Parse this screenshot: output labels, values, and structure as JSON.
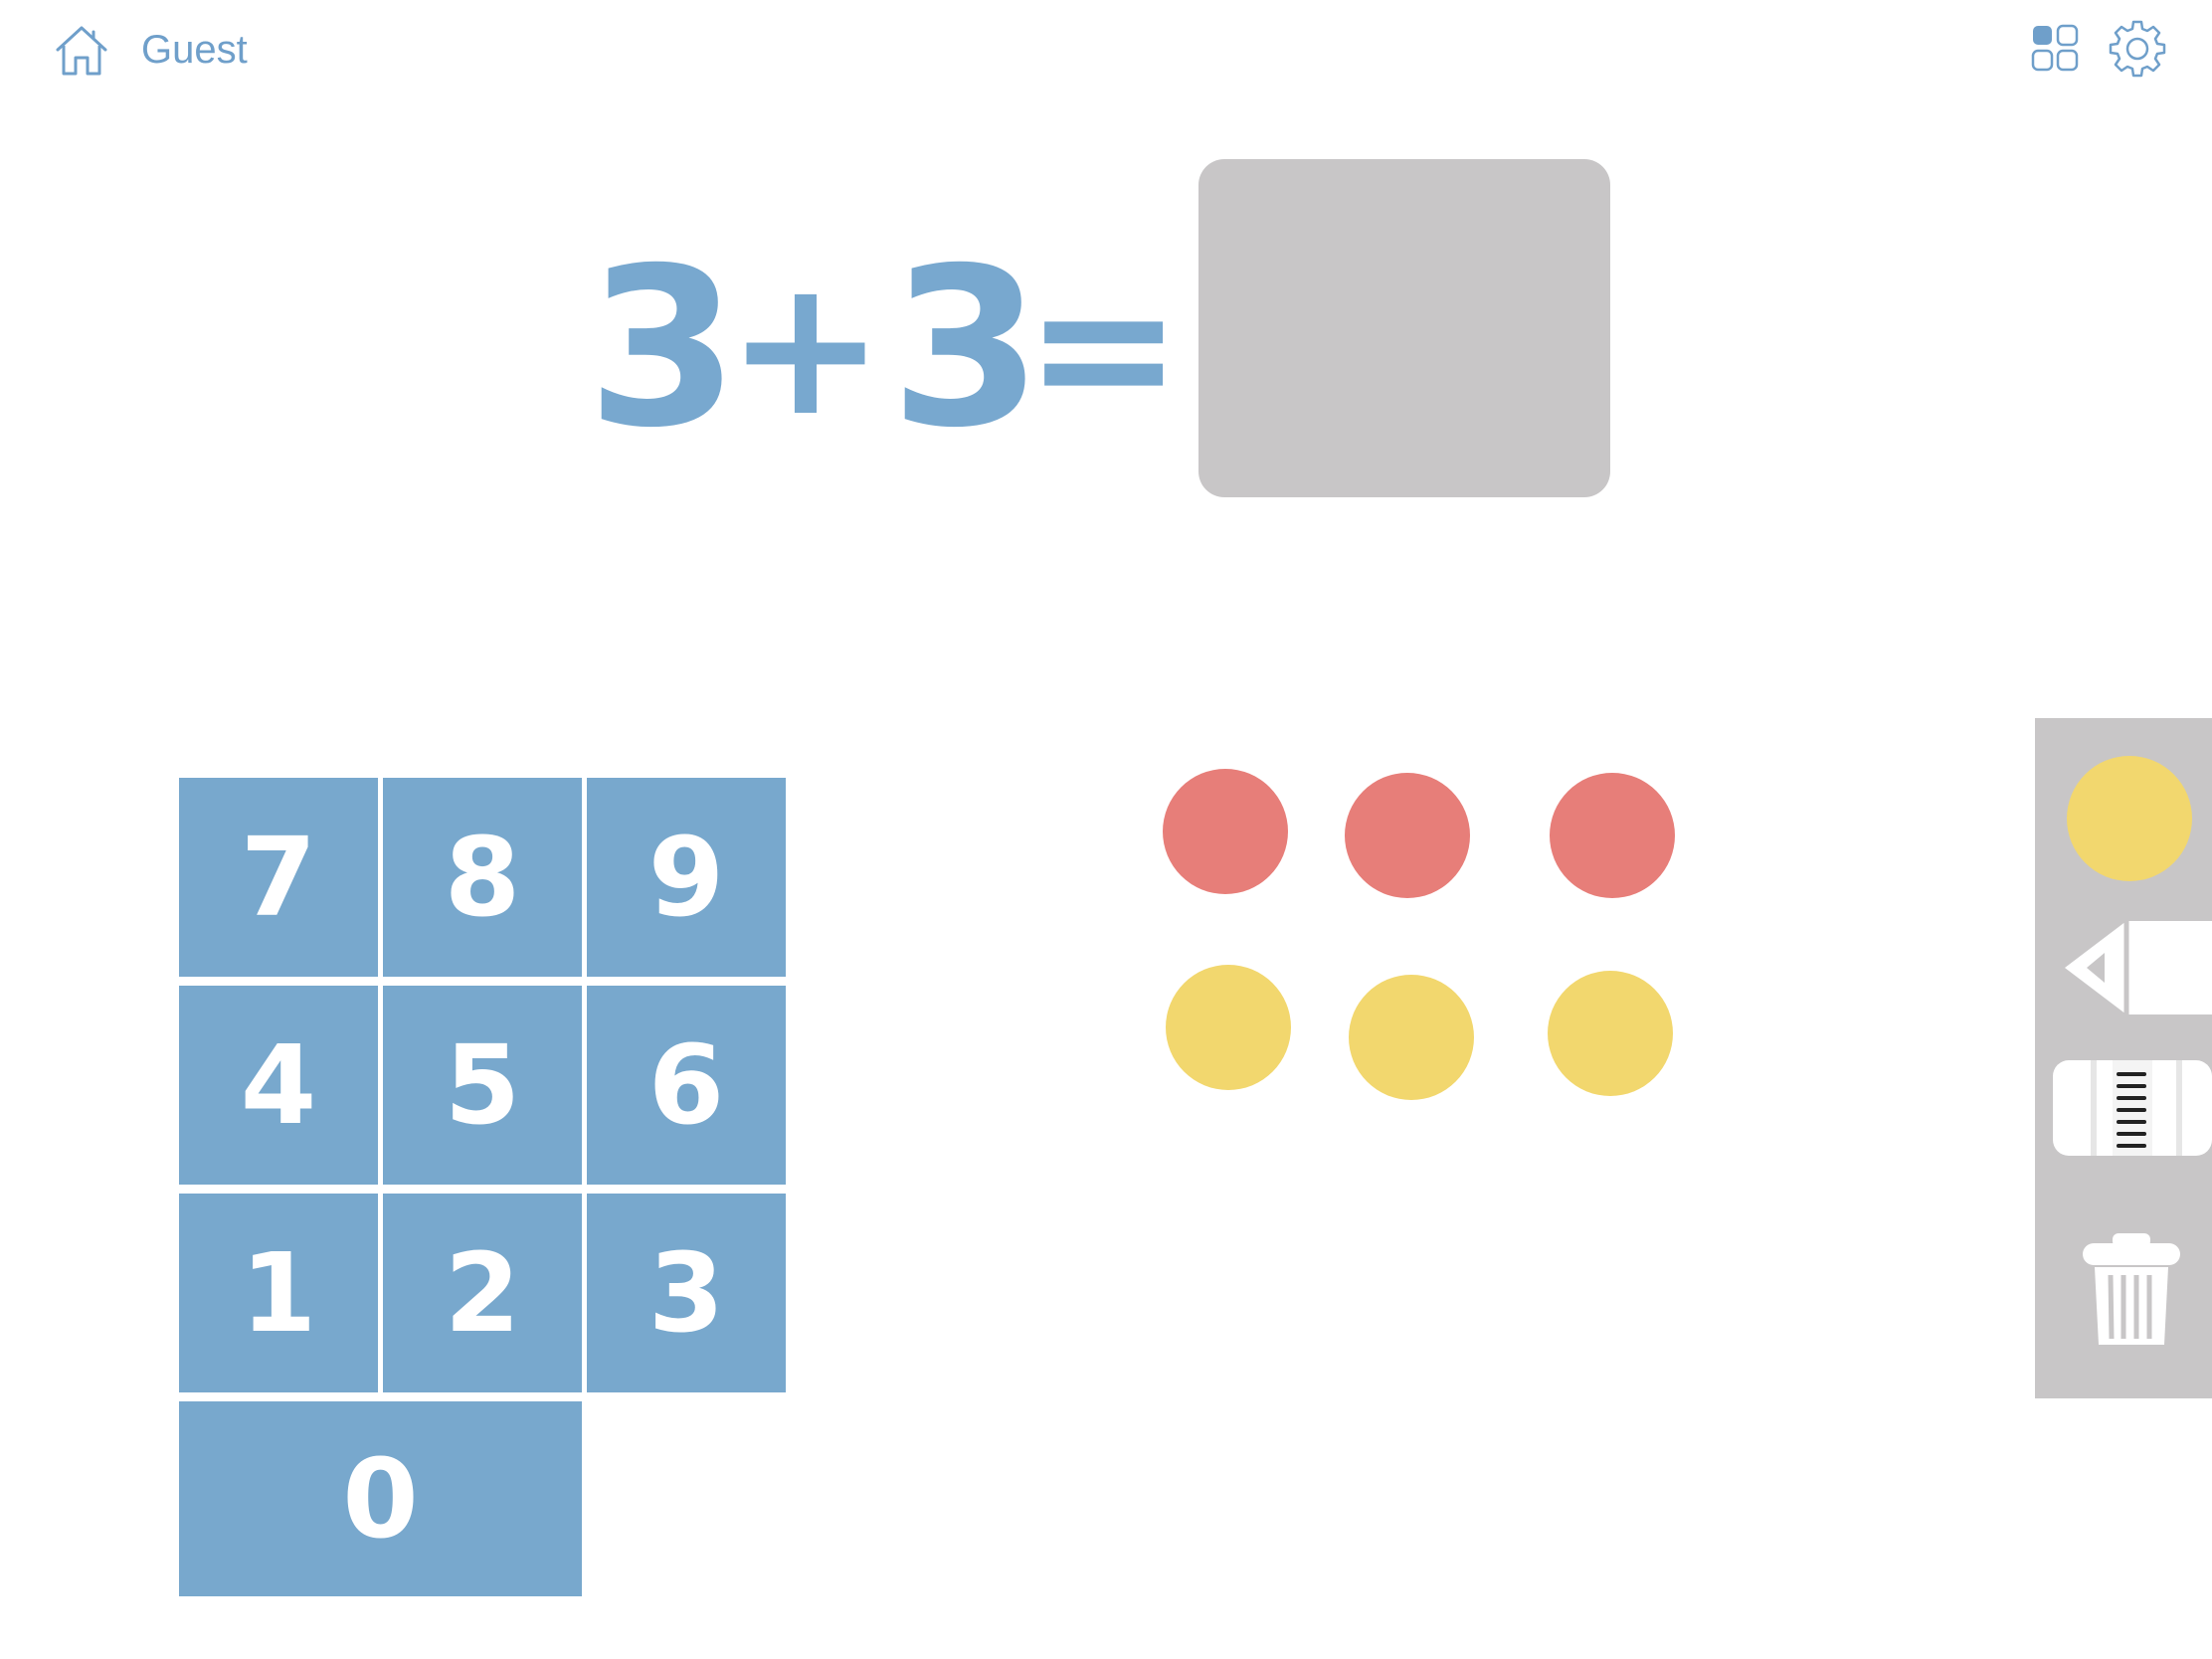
{
  "header": {
    "home_icon": "home-icon",
    "user_label": "Guest",
    "grid_icon": "grid-icon",
    "settings_icon": "gear-icon"
  },
  "equation": {
    "operand_a": "3",
    "operator": "+",
    "operand_b": "3",
    "equals": "=",
    "answer": ""
  },
  "keypad": {
    "keys": [
      "7",
      "8",
      "9",
      "4",
      "5",
      "6",
      "1",
      "2",
      "3",
      "0"
    ]
  },
  "counters": {
    "red_count": 3,
    "yellow_count": 3
  },
  "tools": {
    "items": [
      "yellow-counter-icon",
      "pencil-icon",
      "eraser-icon",
      "trash-icon"
    ]
  },
  "colors": {
    "accent": "#78a8cd",
    "answer_box": "#c8c6c7",
    "red_counter": "#e77e79",
    "yellow_counter": "#f2d76e",
    "tool_panel": "#c8c6c7"
  }
}
